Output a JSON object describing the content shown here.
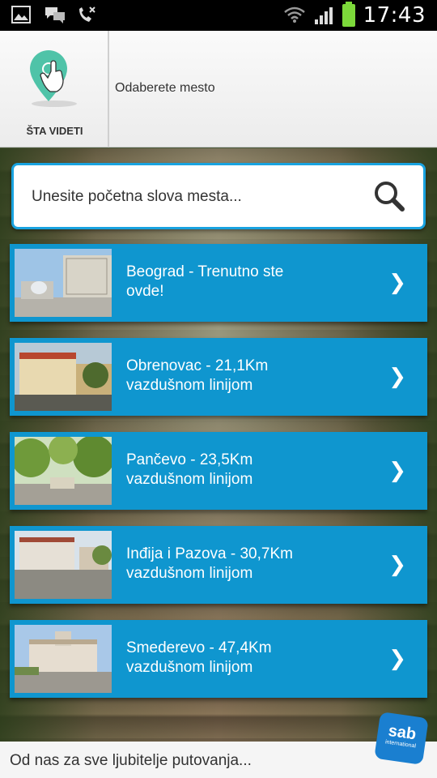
{
  "status_bar": {
    "time": "17:43"
  },
  "header": {
    "logo_label": "ŠTA VIDETI",
    "title": "Odaberete mesto"
  },
  "search": {
    "placeholder": "Unesite početna slova mesta..."
  },
  "places": [
    {
      "line1": "Beograd - Trenutno ste",
      "line2": "ovde!"
    },
    {
      "line1": "Obrenovac - 21,1Km",
      "line2": "vazdušnom linijom"
    },
    {
      "line1": "Pančevo - 23,5Km",
      "line2": "vazdušnom linijom"
    },
    {
      "line1": "Inđija i Pazova - 30,7Km",
      "line2": "vazdušnom linijom"
    },
    {
      "line1": "Smederevo - 47,4Km",
      "line2": "vazdušnom linijom"
    }
  ],
  "footer": {
    "text": "Od nas za sve ljubitelje putovanja..."
  },
  "brand": {
    "logo_text": "sab",
    "logo_subtext": "international"
  },
  "colors": {
    "accent": "#0f96cf",
    "search_border": "#19a3e0",
    "pin": "#4fc3a8"
  }
}
